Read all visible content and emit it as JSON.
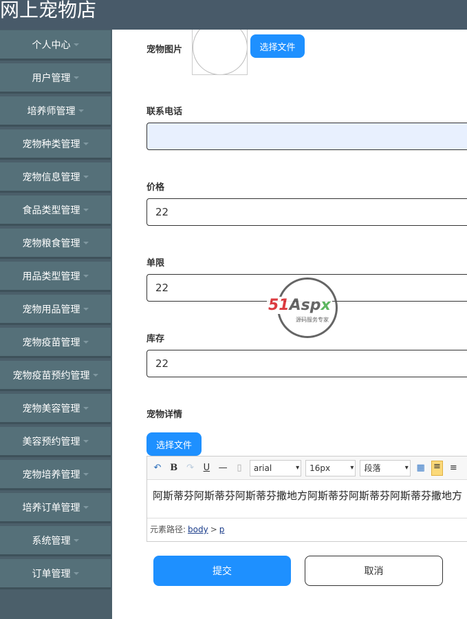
{
  "header": {
    "title": "网上宠物店"
  },
  "sidebar": {
    "items": [
      "个人中心",
      "用户管理",
      "培养师管理",
      "宠物种类管理",
      "宠物信息管理",
      "食品类型管理",
      "宠物粮食管理",
      "用品类型管理",
      "宠物用品管理",
      "宠物疫苗管理",
      "宠物疫苗预约管理",
      "宠物美容管理",
      "美容预约管理",
      "宠物培养管理",
      "培养订单管理",
      "系统管理",
      "订单管理"
    ]
  },
  "form": {
    "image_label": "宠物图片",
    "choose_file": "选择文件",
    "phone_label": "联系电话",
    "phone_value": "",
    "price_label": "价格",
    "price_value": "22",
    "limit_label": "单限",
    "limit_value": "22",
    "stock_label": "库存",
    "stock_value": "22",
    "detail_label": "宠物详情",
    "detail_choose_file": "选择文件",
    "editor": {
      "font": "arial",
      "size": "16px",
      "block": "段落",
      "content": "阿斯蒂芬阿斯蒂芬阿斯蒂芬撒地方阿斯蒂芬阿斯蒂芬阿斯蒂芬撒地方",
      "path_label": "元素路径:",
      "path_body": "body",
      "path_sep": ">",
      "path_p": "p"
    },
    "submit": "提交",
    "cancel": "取消"
  },
  "watermark": {
    "text": "51Aspx",
    "sub": "源码服务专家"
  },
  "colors": {
    "primary": "#1e90ff",
    "sidebar": "#557079",
    "header": "#485a69"
  }
}
